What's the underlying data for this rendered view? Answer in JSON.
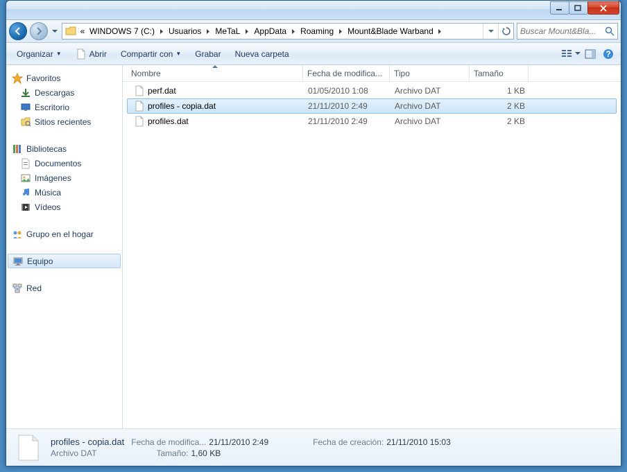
{
  "breadcrumbs": {
    "overflow": "«",
    "items": [
      "WINDOWS 7 (C:)",
      "Usuarios",
      "MeTaL",
      "AppData",
      "Roaming",
      "Mount&Blade Warband"
    ]
  },
  "search": {
    "placeholder": "Buscar Mount&Bla..."
  },
  "toolbar": {
    "organize": "Organizar",
    "open": "Abrir",
    "share": "Compartir con",
    "burn": "Grabar",
    "newfolder": "Nueva carpeta"
  },
  "sidebar": {
    "favorites": {
      "label": "Favoritos",
      "items": [
        "Descargas",
        "Escritorio",
        "Sitios recientes"
      ]
    },
    "libraries": {
      "label": "Bibliotecas",
      "items": [
        "Documentos",
        "Imágenes",
        "Música",
        "Vídeos"
      ]
    },
    "homegroup": {
      "label": "Grupo en el hogar"
    },
    "computer": {
      "label": "Equipo"
    },
    "network": {
      "label": "Red"
    }
  },
  "columns": {
    "name": "Nombre",
    "date": "Fecha de modifica...",
    "type": "Tipo",
    "size": "Tamaño"
  },
  "files": [
    {
      "name": "perf.dat",
      "date": "01/05/2010 1:08",
      "type": "Archivo DAT",
      "size": "1 KB",
      "selected": false
    },
    {
      "name": "profiles - copia.dat",
      "date": "21/11/2010 2:49",
      "type": "Archivo DAT",
      "size": "2 KB",
      "selected": true
    },
    {
      "name": "profiles.dat",
      "date": "21/11/2010 2:49",
      "type": "Archivo DAT",
      "size": "2 KB",
      "selected": false
    }
  ],
  "details": {
    "title": "profiles - copia.dat",
    "subtitle": "Archivo DAT",
    "meta": [
      {
        "label": "Fecha de modifica...",
        "value": "21/11/2010 2:49"
      },
      {
        "label": "Tamaño:",
        "value": "1,60 KB"
      },
      {
        "label": "Fecha de creación:",
        "value": "21/11/2010 15:03"
      }
    ]
  }
}
